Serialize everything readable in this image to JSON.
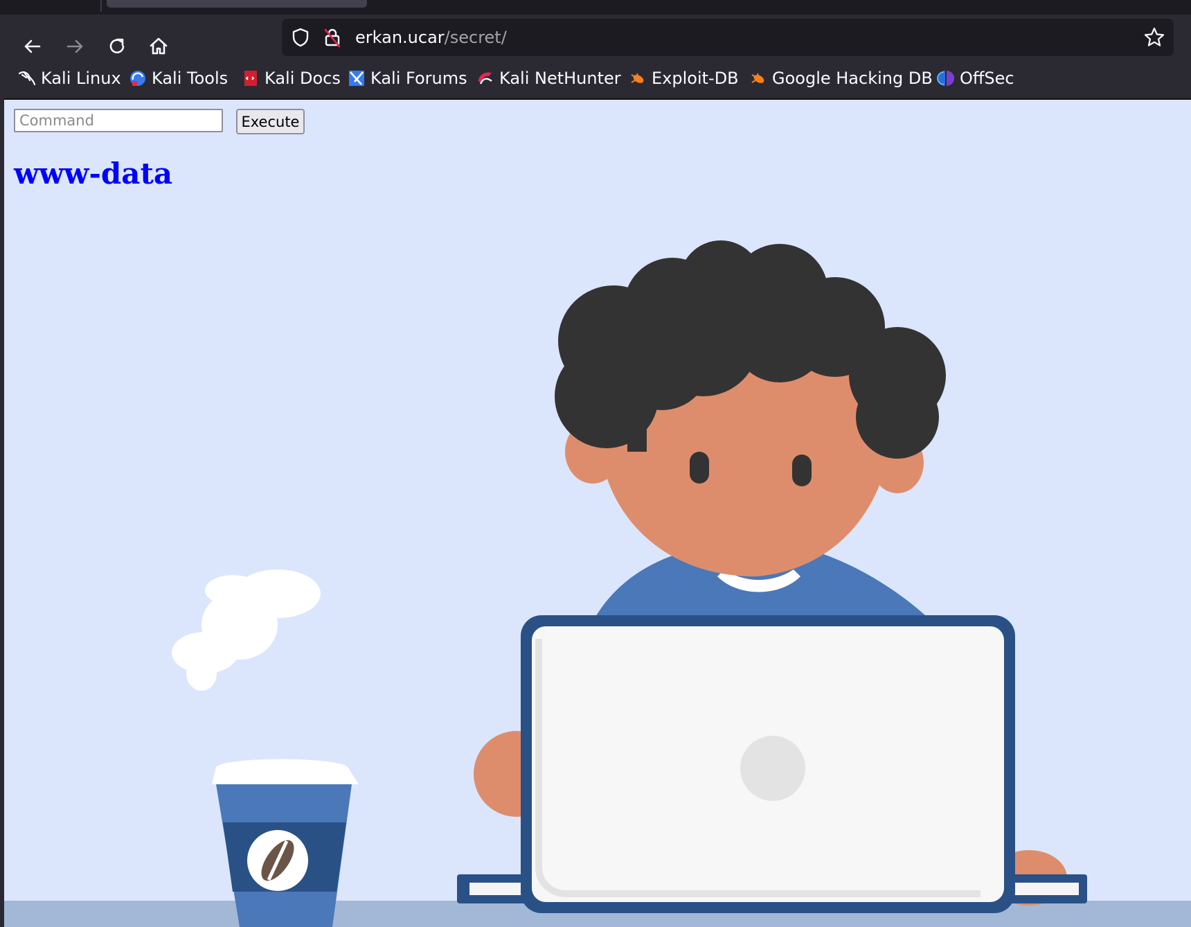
{
  "browser": {
    "nav": {
      "back_icon": "arrow-left",
      "forward_icon": "arrow-right",
      "reload_icon": "reload",
      "home_icon": "home"
    },
    "url": {
      "host": "erkan.ucar",
      "path": "/secret/"
    },
    "bookmarks": [
      {
        "label": "Kali Linux",
        "icon": "kali-dragon"
      },
      {
        "label": "Kali Tools",
        "icon": "kali-tools"
      },
      {
        "label": "Kali Docs",
        "icon": "kali-docs"
      },
      {
        "label": "Kali Forums",
        "icon": "kali-forums"
      },
      {
        "label": "Kali NetHunter",
        "icon": "kali-nethunter"
      },
      {
        "label": "Exploit-DB",
        "icon": "exploit-db"
      },
      {
        "label": "Google Hacking DB",
        "icon": "exploit-db"
      },
      {
        "label": "OffSec",
        "icon": "offsec"
      }
    ]
  },
  "page": {
    "command_input": {
      "placeholder": "Command",
      "value": ""
    },
    "execute_label": "Execute",
    "output": "www-data"
  },
  "colors": {
    "page_background": "#dbe6fd",
    "output_text": "#0000ff",
    "browser_chrome": "#2b2a33"
  }
}
